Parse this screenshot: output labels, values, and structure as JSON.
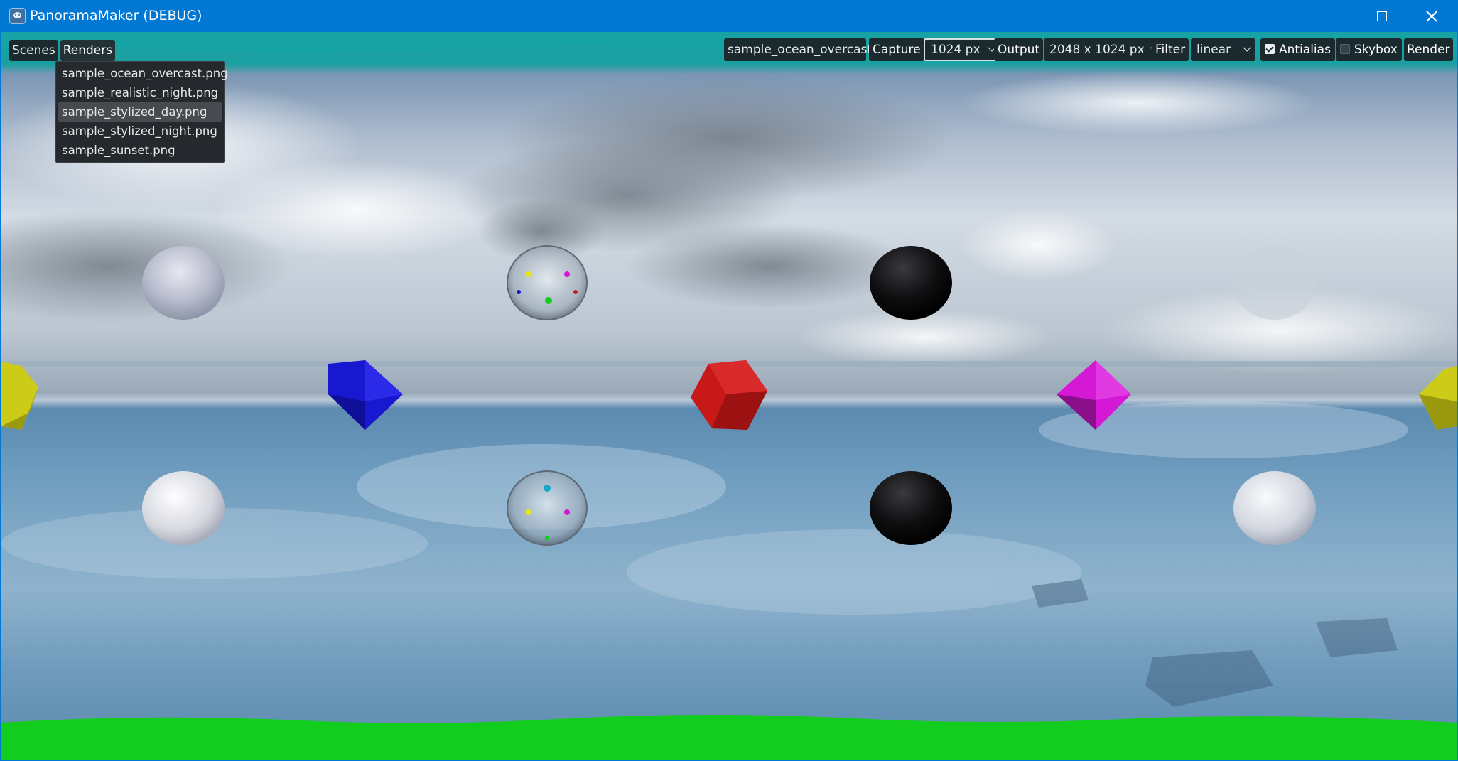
{
  "window": {
    "title": "PanoramaMaker (DEBUG)",
    "icon": "godot-icon",
    "controls": [
      "minimize-icon",
      "maximize-icon",
      "close-icon"
    ]
  },
  "menubar": {
    "scenes_label": "Scenes",
    "renders_label": "Renders"
  },
  "renders_menu": {
    "items": [
      "sample_ocean_overcast.png",
      "sample_realistic_night.png",
      "sample_stylized_day.png",
      "sample_stylized_night.png",
      "sample_sunset.png"
    ],
    "hovered_index": 2
  },
  "toolbar": {
    "scene_name": "sample_ocean_overcast",
    "capture_label": "Capture",
    "capture_value": "1024 px",
    "output_label": "Output",
    "output_value": "2048 x 1024 px",
    "filter_label": "Filter",
    "filter_value": "linear",
    "antialias_label": "Antialias",
    "antialias_checked": true,
    "skybox_label": "Skybox",
    "skybox_checked": false,
    "render_label": "Render"
  },
  "colors": {
    "titlebar": "#0078d4",
    "panel": "#1b2a2e",
    "cube_blue": "#1515c8",
    "cube_red": "#c81818",
    "cube_magenta": "#d418d4",
    "cube_yellow": "#cccc18",
    "ground_green": "#12cc1e"
  }
}
